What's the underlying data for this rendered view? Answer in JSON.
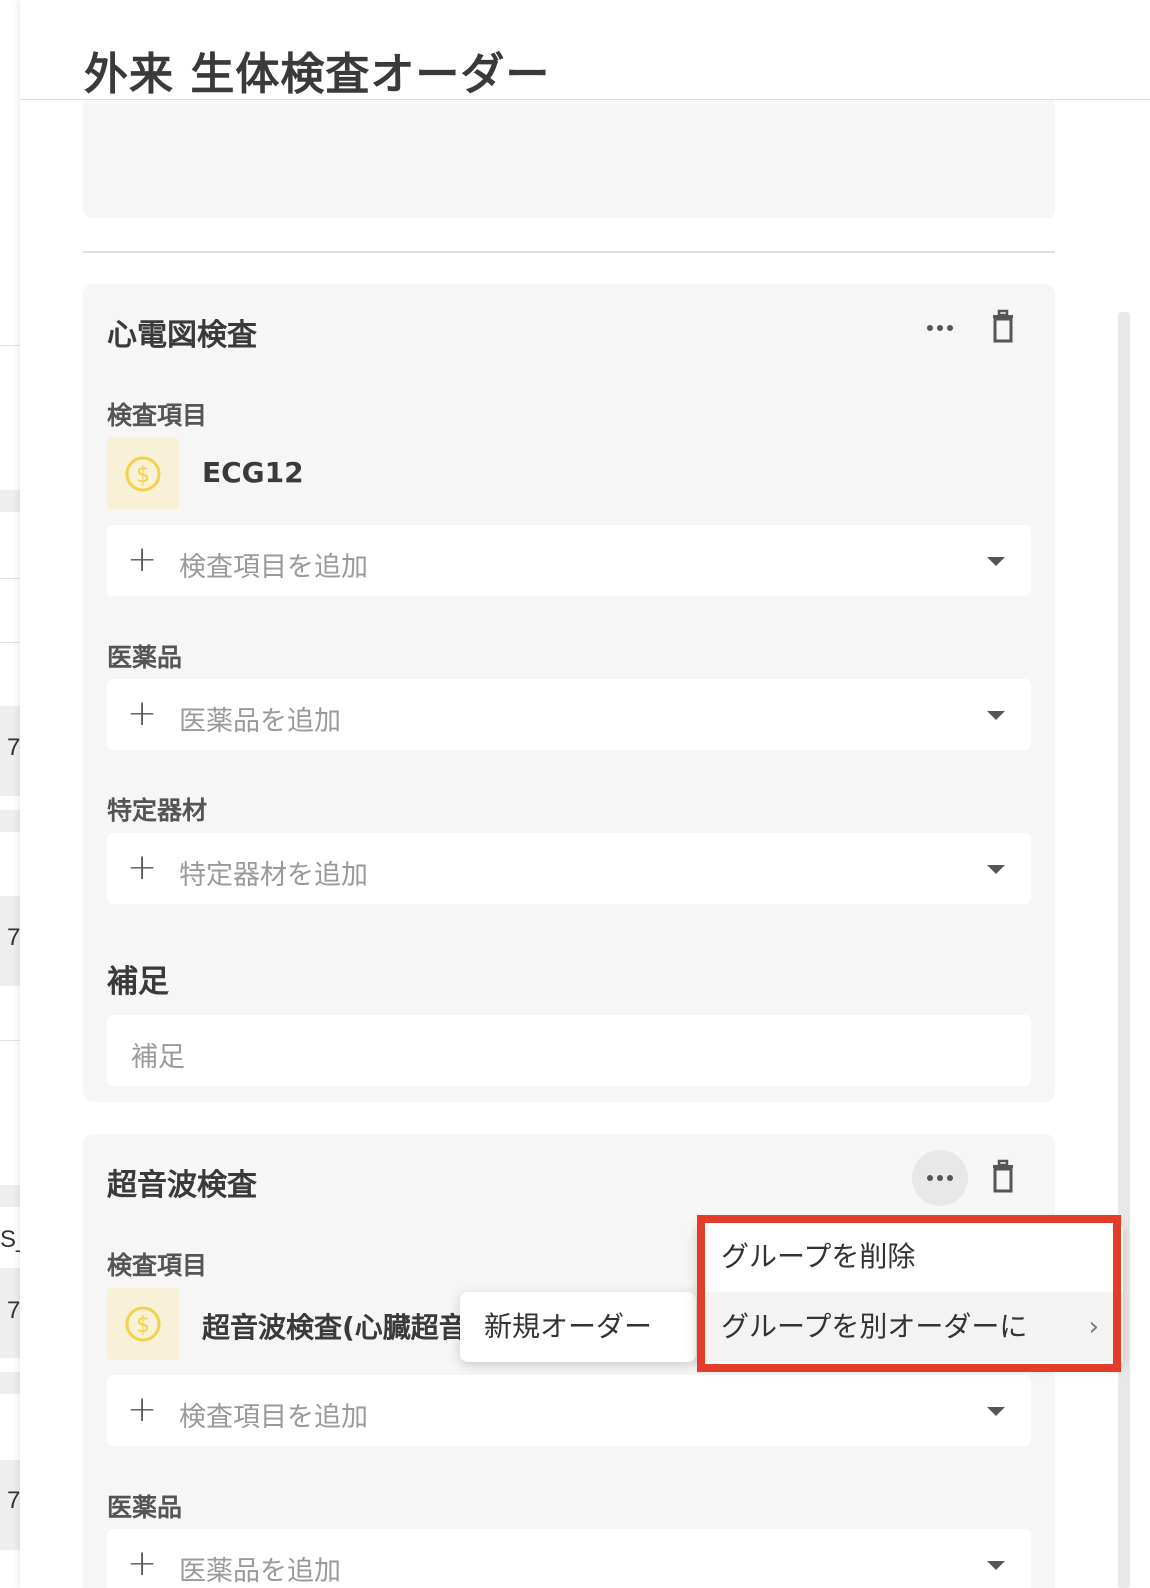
{
  "header": {
    "title": "外来 生体検査オーダー"
  },
  "background_page": {
    "fragments": [
      "7",
      "7",
      "S_",
      "7",
      "7"
    ]
  },
  "groups": [
    {
      "title": "心電図検査",
      "exam_label": "検査項目",
      "exam_item": "ECG12",
      "exam_add": "検査項目を追加",
      "drug_label": "医薬品",
      "drug_add": "医薬品を追加",
      "material_label": "特定器材",
      "material_add": "特定器材を追加",
      "note_label": "補足",
      "note_placeholder": "補足"
    },
    {
      "title": "超音波検査",
      "exam_label": "検査項目",
      "exam_item": "超音波検査(心臓超音",
      "exam_add": "検査項目を追加",
      "drug_label": "医薬品",
      "drug_add": "医薬品を追加"
    }
  ],
  "group_menu": {
    "items": [
      {
        "label": "グループを削除"
      },
      {
        "label": "グループを別オーダーに",
        "has_submenu": true
      }
    ]
  },
  "submenu": {
    "items": [
      {
        "label": "新規オーダー"
      }
    ]
  },
  "colors": {
    "highlight": "#e23d28",
    "coin": "#f2d24b",
    "coin_bg": "#f8f1d8",
    "card_bg": "#f6f6f6"
  },
  "icons": [
    "more-horizontal-icon",
    "trash-icon",
    "coin-icon",
    "plus-icon",
    "caret-down-icon",
    "chevron-right-icon"
  ]
}
